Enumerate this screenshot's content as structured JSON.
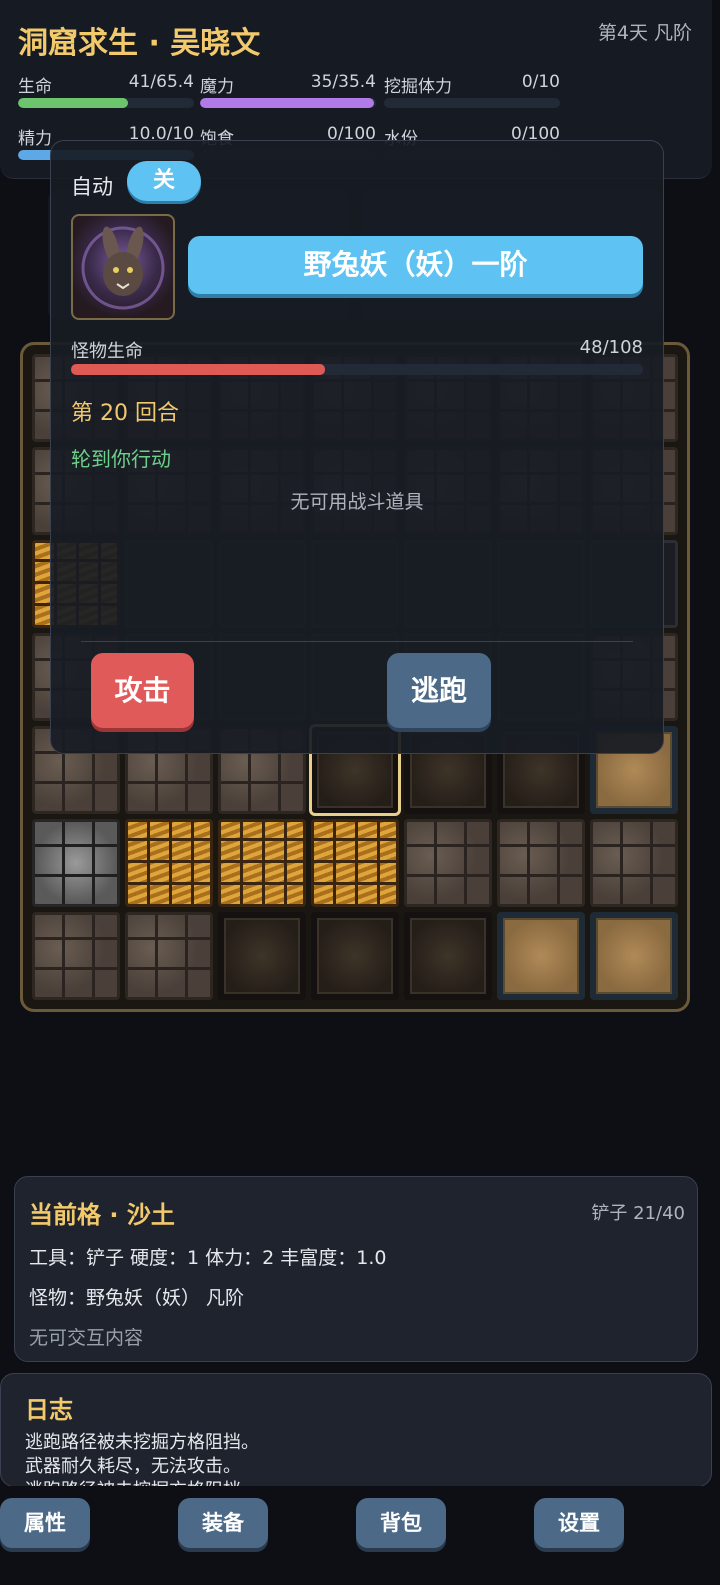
{
  "header": {
    "title": "洞窟求生 · 吴晓文",
    "day": "第4天 凡阶",
    "stats": [
      {
        "label": "生命",
        "value": "41/65.4",
        "fraction": 0.627,
        "color": "#6cc46c"
      },
      {
        "label": "魔力",
        "value": "35/35.4",
        "fraction": 0.99,
        "color": "#b07ae8"
      },
      {
        "label": "挖掘体力",
        "value": "0/10",
        "fraction": 0,
        "color": "#5ea8e8"
      },
      {
        "label": "精力",
        "value": "10.0/10",
        "fraction": 1.0,
        "color": "#5ea8e8"
      },
      {
        "label": "饱食",
        "value": "0/100",
        "fraction": 0,
        "color": "#e0a04a"
      },
      {
        "label": "水份",
        "value": "0/100",
        "fraction": 0,
        "color": "#5ec2f2"
      }
    ]
  },
  "battle": {
    "auto_label": "自动",
    "auto_toggle": "关",
    "monster_name": "野兔妖（妖）一阶",
    "monster_hp_label": "怪物生命",
    "monster_hp_value": "48/108",
    "monster_hp_fraction": 0.444,
    "round_text": "第 20 回合",
    "turn_text": "轮到你行动",
    "no_item_text": "无可用战斗道具",
    "attack_label": "攻击",
    "flee_label": "逃跑"
  },
  "board": {
    "tiles": [
      "stone",
      "stone",
      "stone",
      "stone",
      "stone",
      "stone",
      "stone",
      "stone",
      "stone",
      "stone",
      "stone",
      "stone",
      "stone",
      "stone",
      "gold",
      "dark",
      "dark",
      "dark",
      "dark",
      "dark",
      "dark",
      "stone",
      "dark",
      "dark",
      "dark",
      "dark",
      "dark",
      "stone",
      "stone",
      "stone",
      "stone",
      "dirt-selected",
      "dirt",
      "dirt",
      "sand",
      "iron",
      "gold",
      "gold",
      "gold",
      "stone",
      "stone",
      "stone",
      "stone",
      "stone",
      "dirt",
      "dirt",
      "dirt",
      "sand",
      "sand"
    ]
  },
  "info": {
    "title": "当前格 · 沙土",
    "tool": "铲子 21/40",
    "line1": "工具：铲子 硬度：1 体力：2 丰富度：1.0",
    "line2": "怪物：野兔妖（妖） 凡阶",
    "empty": "无可交互内容"
  },
  "log": {
    "title": "日志",
    "lines": [
      "逃跑路径被未挖掘方格阻挡。",
      "武器耐久耗尽，无法攻击。",
      "逃跑路径被未挖掘方格阻挡。"
    ]
  },
  "nav": {
    "items": [
      "属性",
      "装备",
      "背包",
      "设置"
    ]
  }
}
